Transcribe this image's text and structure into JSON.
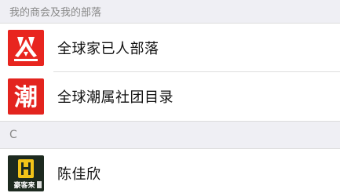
{
  "section_header": "我的商会及我的部落",
  "groups": [
    {
      "name": "全球家已人部落",
      "avatar_icon": "red-tribe-logo-icon",
      "avatar_color": "#e8251f"
    },
    {
      "name": "全球潮属社团目录",
      "avatar_icon": "red-chao-character-icon",
      "avatar_color": "#e3241e",
      "avatar_text": "潮"
    }
  ],
  "index_letter": "C",
  "contacts": [
    {
      "name": "陈佳欣",
      "avatar_icon": "hao-ke-lai-logo-icon",
      "avatar_color": "#1d2a1f",
      "avatar_accent": "#f2c318",
      "avatar_text": "豪客来"
    }
  ]
}
